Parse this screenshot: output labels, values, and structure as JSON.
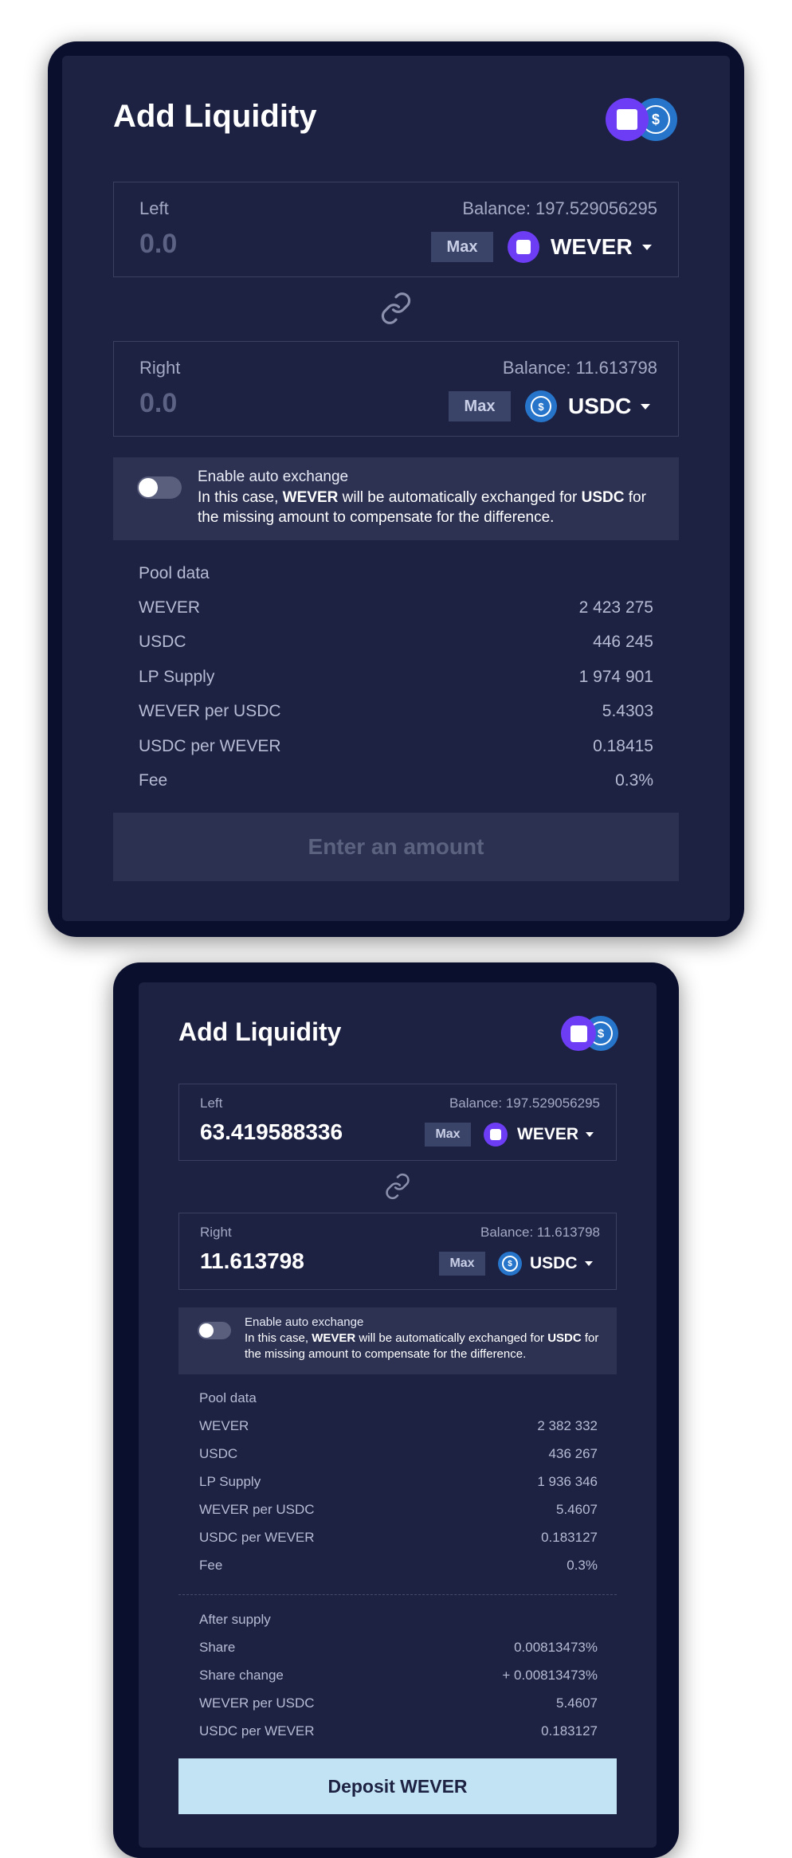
{
  "panel1": {
    "title": "Add Liquidity",
    "left": {
      "label": "Left",
      "balance": "Balance: 197.529056295",
      "value": "0.0",
      "max_label": "Max",
      "token": "WEVER"
    },
    "right": {
      "label": "Right",
      "balance": "Balance: 11.613798",
      "value": "0.0",
      "max_label": "Max",
      "token": "USDC"
    },
    "auto_exchange": {
      "enabled": false,
      "title": "Enable auto exchange",
      "desc_prefix": "In this case,",
      "desc_token_from": "WEVER",
      "desc_middle": "will be automatically exchanged for",
      "desc_token_to": "USDC",
      "desc_suffix": "for the missing amount to compensate for the difference."
    },
    "pool_data": {
      "heading": "Pool data",
      "rows": [
        {
          "label": "WEVER",
          "value": "2 423 275"
        },
        {
          "label": "USDC",
          "value": "446 245"
        },
        {
          "label": "LP Supply",
          "value": "1 974 901"
        },
        {
          "label": "WEVER per USDC",
          "value": "5.4303"
        },
        {
          "label": "USDC per WEVER",
          "value": "0.18415"
        },
        {
          "label": "Fee",
          "value": "0.3%"
        }
      ]
    },
    "button": "Enter an amount"
  },
  "panel2": {
    "title": "Add Liquidity",
    "left": {
      "label": "Left",
      "balance": "Balance: 197.529056295",
      "value": "63.419588336",
      "max_label": "Max",
      "token": "WEVER"
    },
    "right": {
      "label": "Right",
      "balance": "Balance: 11.613798",
      "value": "11.613798",
      "max_label": "Max",
      "token": "USDC"
    },
    "auto_exchange": {
      "enabled": false,
      "title": "Enable auto exchange",
      "desc_prefix": "In this case,",
      "desc_token_from": "WEVER",
      "desc_middle": "will be automatically exchanged for",
      "desc_token_to": "USDC",
      "desc_suffix": "for the missing amount to compensate for the difference."
    },
    "pool_data": {
      "heading": "Pool data",
      "rows": [
        {
          "label": "WEVER",
          "value": "2 382 332"
        },
        {
          "label": "USDC",
          "value": "436 267"
        },
        {
          "label": "LP Supply",
          "value": "1 936 346"
        },
        {
          "label": "WEVER per USDC",
          "value": "5.4607"
        },
        {
          "label": "USDC per WEVER",
          "value": "0.183127"
        },
        {
          "label": "Fee",
          "value": "0.3%"
        }
      ]
    },
    "after_supply": {
      "heading": "After supply",
      "rows": [
        {
          "label": "Share",
          "value": "0.00813473%"
        },
        {
          "label": "Share change",
          "value": "+ 0.00813473%"
        },
        {
          "label": "WEVER per USDC",
          "value": "5.4607"
        },
        {
          "label": "USDC per WEVER",
          "value": "0.183127"
        }
      ]
    },
    "button": "Deposit WEVER"
  },
  "colors": {
    "frame": "#0b0f2e",
    "card": "#1d2142",
    "wever": "#6c3df5",
    "usdc": "#2775ca",
    "deposit_button": "#c2e3f3"
  },
  "icons": {
    "wever": "wever-token-icon",
    "usdc": "usdc-token-icon",
    "link": "link-icon",
    "dropdown": "chevron-down-icon"
  }
}
